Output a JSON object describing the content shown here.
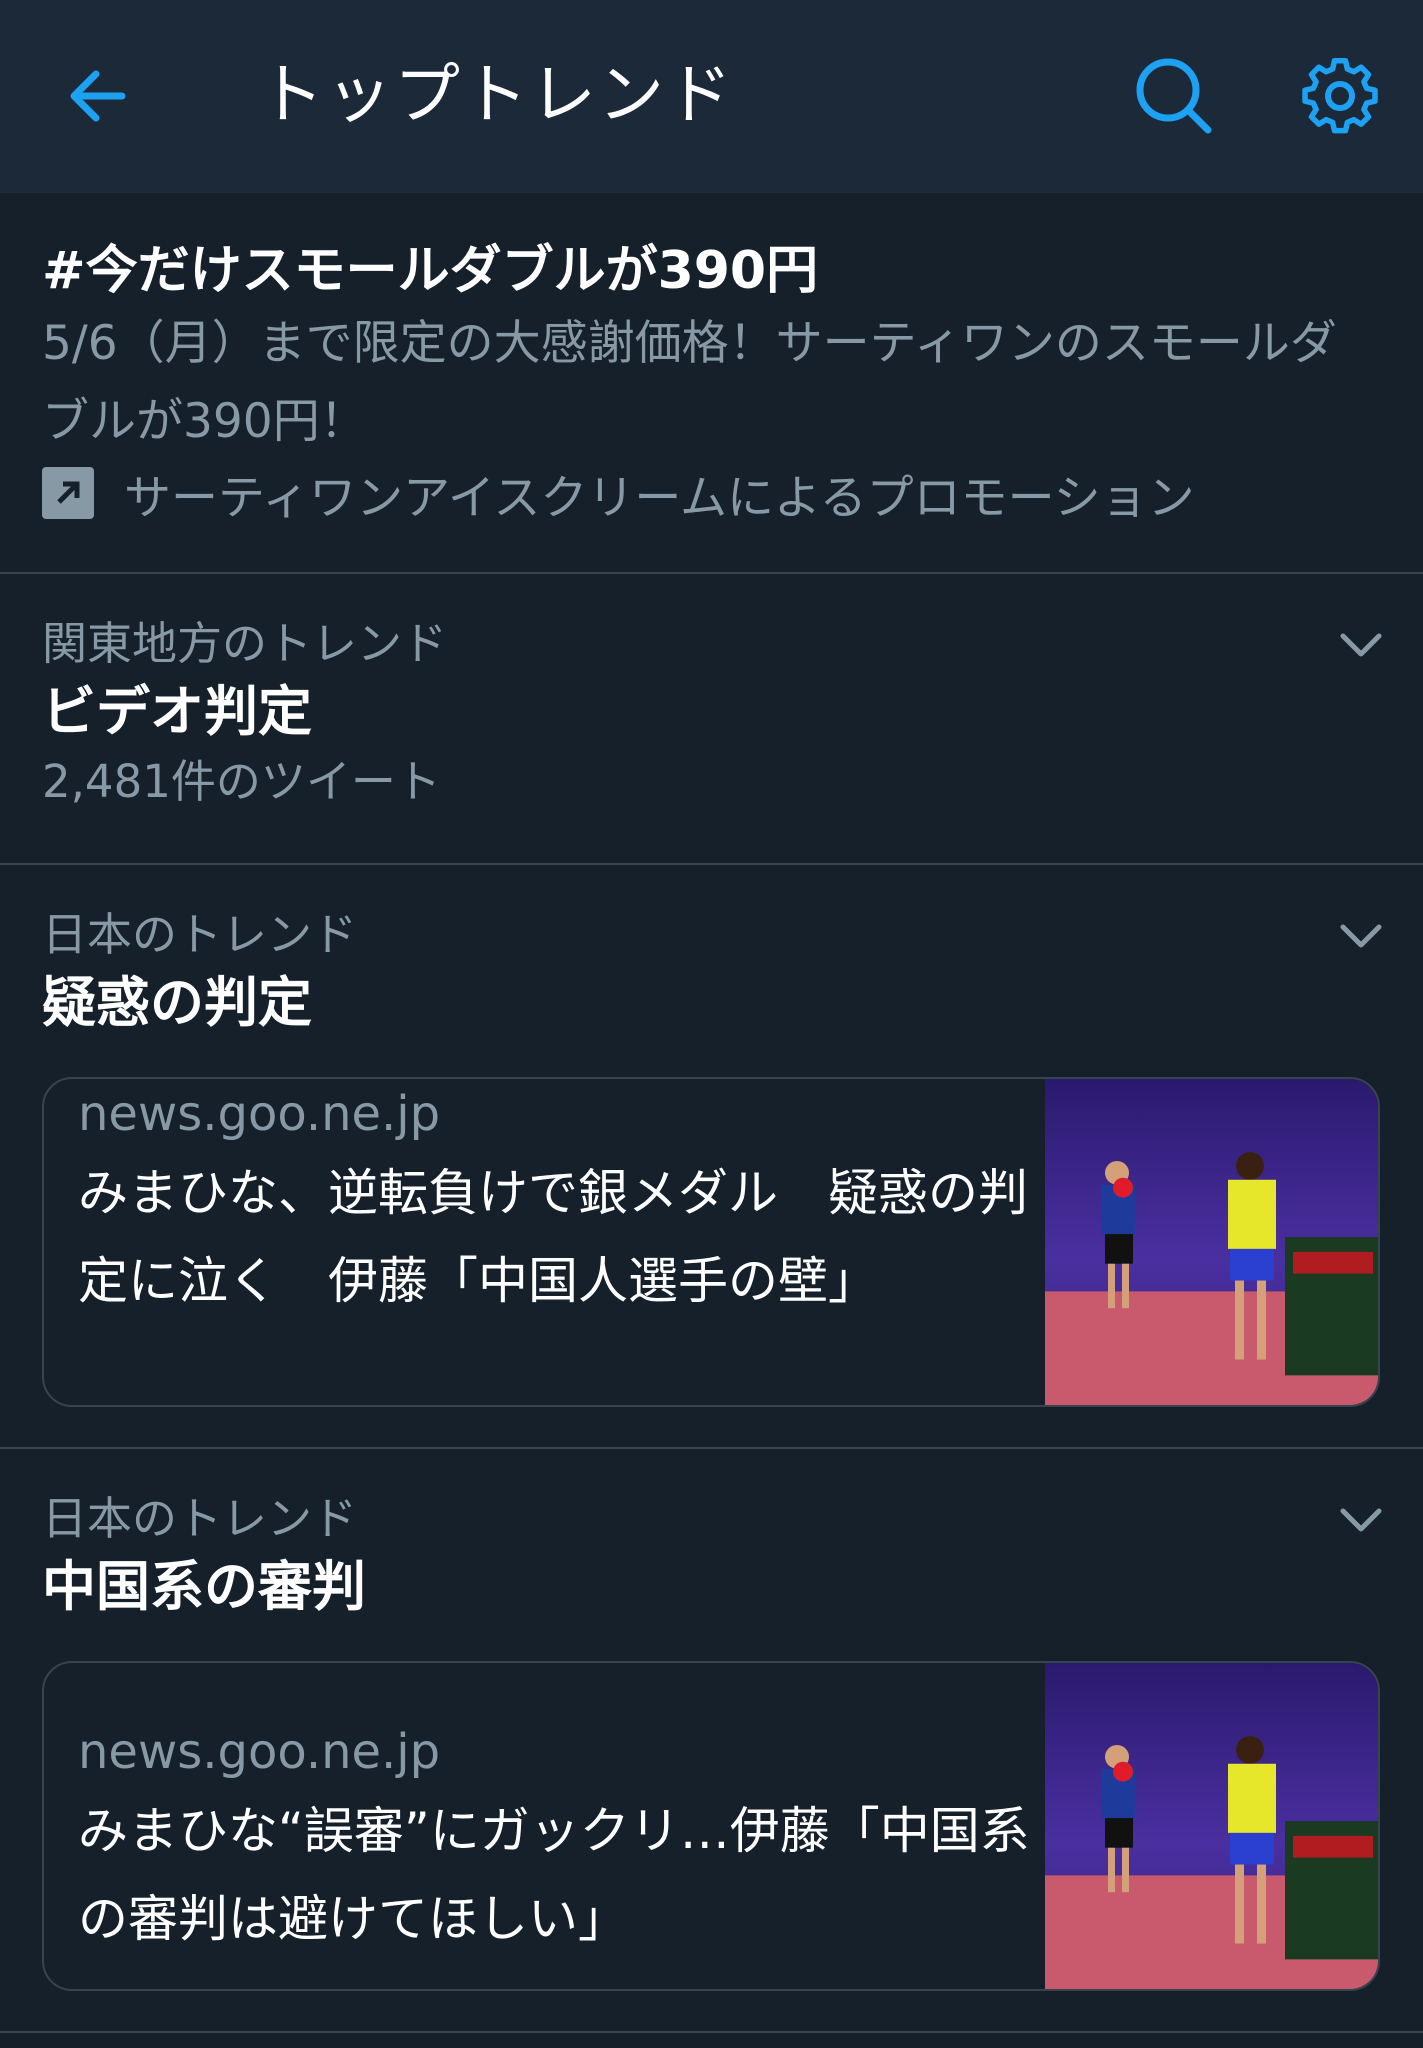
{
  "header": {
    "title": "トップトレンド",
    "accent_color": "#1da1f2",
    "icons": [
      "back-arrow-icon",
      "search-icon",
      "gear-icon"
    ]
  },
  "promo": {
    "title": "#今だけスモールダブルが390円",
    "description": "5/6（月）まで限定の大感謝価格！サーティワンのスモールダブルが390円！",
    "promoted_by": "サーティワンアイスクリームによるプロモーション",
    "icon": "promoted-arrow-icon"
  },
  "trends": [
    {
      "context": "関東地方のトレンド",
      "name": "ビデオ判定",
      "count": "2,481件のツイート"
    },
    {
      "context": "日本のトレンド",
      "name": "疑惑の判定",
      "card": {
        "domain": "news.goo.ne.jp",
        "headline": "みまひな、逆転負けで銀メダル　疑惑の判定に泣く　伊藤「中国人選手の壁」"
      }
    },
    {
      "context": "日本のトレンド",
      "name": "中国系の審判",
      "card": {
        "domain": "news.goo.ne.jp",
        "headline": "みまひな“誤審”にガックリ…伊藤「中国系の審判は避けてほしい」"
      }
    }
  ],
  "colors": {
    "background": "#15202b",
    "header_bg": "#1c2938",
    "secondary_text": "#8899a6",
    "divider": "#38444d"
  }
}
